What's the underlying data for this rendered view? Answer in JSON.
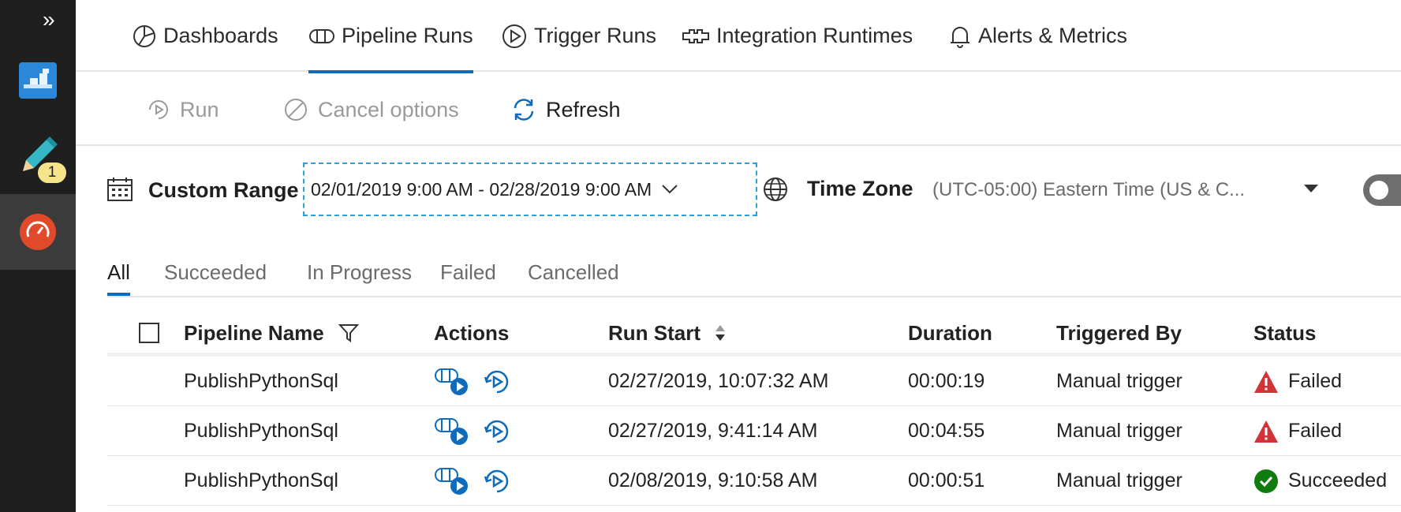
{
  "rail": {
    "expand_icon": "double-chevron-right",
    "items": [
      {
        "name": "factory-icon"
      },
      {
        "name": "author-pencil-icon",
        "badge": "1"
      },
      {
        "name": "monitor-gauge-icon"
      }
    ]
  },
  "topnav": {
    "tabs": [
      {
        "label": "Dashboards",
        "icon": "pie-chart-icon"
      },
      {
        "label": "Pipeline Runs",
        "icon": "pipeline-icon",
        "active": true
      },
      {
        "label": "Trigger Runs",
        "icon": "play-circle-icon"
      },
      {
        "label": "Integration Runtimes",
        "icon": "runtime-icon"
      },
      {
        "label": "Alerts & Metrics",
        "icon": "bell-icon"
      }
    ]
  },
  "toolbar": {
    "run_label": "Run",
    "cancel_label": "Cancel options",
    "refresh_label": "Refresh"
  },
  "filters": {
    "range_label": "Custom Range",
    "range_value": "02/01/2019 9:00 AM - 02/28/2019 9:00 AM",
    "timezone_label": "Time Zone",
    "timezone_value": "(UTC-05:00) Eastern Time (US & C..."
  },
  "status_tabs": [
    "All",
    "Succeeded",
    "In Progress",
    "Failed",
    "Cancelled"
  ],
  "table": {
    "columns": {
      "pipeline_name": "Pipeline Name",
      "actions": "Actions",
      "run_start": "Run Start",
      "duration": "Duration",
      "triggered_by": "Triggered By",
      "status": "Status"
    },
    "rows": [
      {
        "pipeline_name": "PublishPythonSql",
        "run_start": "02/27/2019, 10:07:32 AM",
        "duration": "00:00:19",
        "triggered_by": "Manual trigger",
        "status": "Failed"
      },
      {
        "pipeline_name": "PublishPythonSql",
        "run_start": "02/27/2019, 9:41:14 AM",
        "duration": "00:04:55",
        "triggered_by": "Manual trigger",
        "status": "Failed"
      },
      {
        "pipeline_name": "PublishPythonSql",
        "run_start": "02/08/2019, 9:10:58 AM",
        "duration": "00:00:51",
        "triggered_by": "Manual trigger",
        "status": "Succeeded"
      }
    ]
  },
  "colors": {
    "accent": "#0f6cbd",
    "failed": "#d13438",
    "succeeded": "#107c10",
    "rail_bg": "#1f1f1f"
  }
}
